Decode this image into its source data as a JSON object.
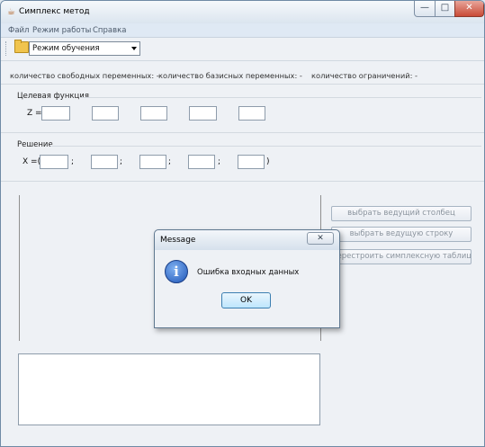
{
  "window": {
    "title": "Симплекс метод",
    "minimize_glyph": "—",
    "maximize_glyph": "□",
    "close_glyph": "✕"
  },
  "menu": [
    "Файл",
    "Режим работы",
    "Справка"
  ],
  "toolbar": {
    "icon": "folder-open-icon",
    "mode_select": "Режим обучения"
  },
  "counts": {
    "free_vars": "количество свободных переменных:  -",
    "basis_vars": "количество базисных переменных:  -",
    "constraints": "количество ограничений:  -"
  },
  "objective": {
    "section_title": "Целевая функция",
    "label": "Z ="
  },
  "solution": {
    "section_title": "Решение",
    "label": "X =(",
    "separator": ";",
    "closing": ")"
  },
  "buttons": {
    "pivot_column": "выбрать ведущий столбец",
    "pivot_row": "выбрать ведущую строку",
    "rebuild": "перестроить симплексную таблицу"
  },
  "dialog": {
    "title": "Message",
    "close_glyph": "✕",
    "message": "Ошибка входных данных",
    "ok": "OK",
    "icon": "info-icon"
  }
}
